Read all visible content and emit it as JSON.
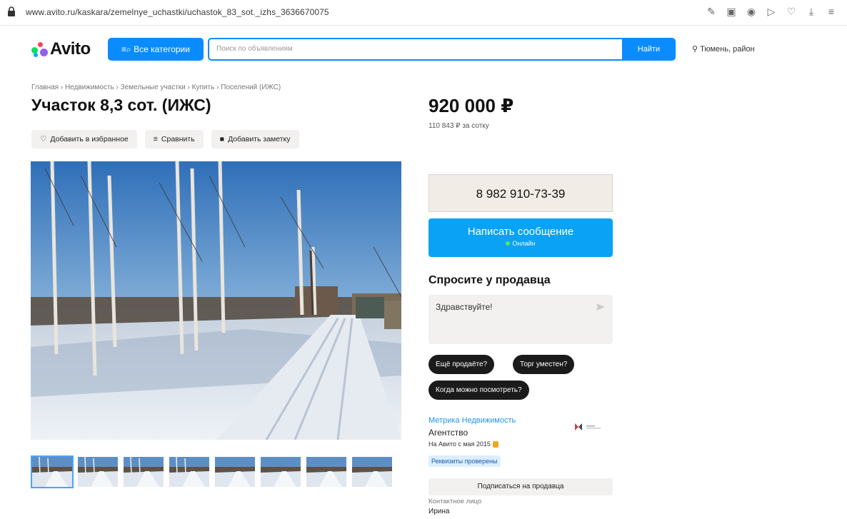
{
  "browser": {
    "url": "www.avito.ru/kaskara/zemelnye_uchastki/uchastok_83_sot._izhs_3636670075",
    "toolbar_icons": [
      "edit-icon",
      "camera-icon",
      "shield-icon",
      "send-icon",
      "heart-icon",
      "download-icon",
      "menu-icon"
    ]
  },
  "header": {
    "logo_text": "Avito",
    "categories_label": "Все категории",
    "search_placeholder": "Поиск по объявлениям",
    "search_button": "Найти",
    "location": "Тюмень, район"
  },
  "breadcrumb": [
    "Главная",
    "Недвижимость",
    "Земельные участки",
    "Купить",
    "Поселений (ИЖС)"
  ],
  "listing": {
    "title": "Участок 8,3 сот. (ИЖС)",
    "actions": {
      "favorite": "Добавить в избранное",
      "compare": "Сравнить",
      "note": "Добавить заметку"
    },
    "price": "920 000 ₽",
    "price_per_sotka": "110 843 ₽ за сотку",
    "thumbnail_count": 8
  },
  "contact": {
    "phone": "8 982 910-73-39",
    "message_button": "Написать сообщение",
    "online_label": "Онлайн",
    "ask_title": "Спросите у продавца",
    "ask_placeholder": "Здравствуйте!",
    "chips": [
      "Ещё продаёте?",
      "Торг уместен?",
      "Когда можно посмотреть?"
    ]
  },
  "seller": {
    "name": "Метрика Недвижимость",
    "type": "Агентство",
    "since": "На Авито с мая 2015",
    "verified": "Реквизиты проверены",
    "subscribe": "Подписаться на продавца",
    "contact_label": "Контактное лицо",
    "contact_name": "Ирина"
  },
  "colors": {
    "accent_blue": "#0a8cff",
    "message_blue": "#0aa2f5",
    "phone_bg": "#f1ede6"
  }
}
